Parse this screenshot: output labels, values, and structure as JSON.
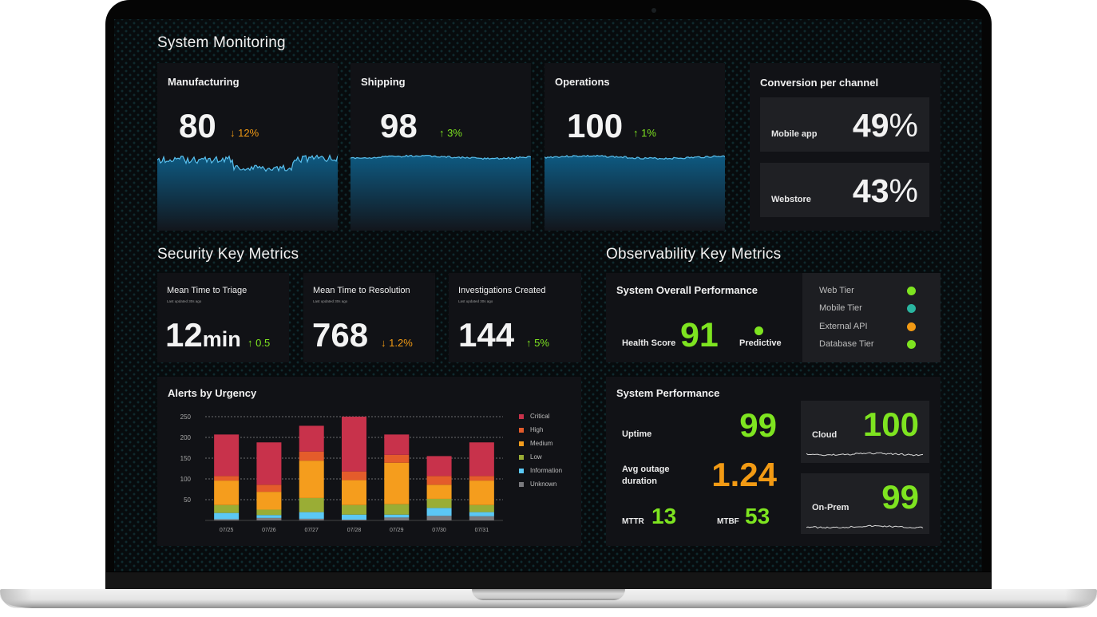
{
  "system_monitoring": {
    "title": "System Monitoring",
    "cards": [
      {
        "name": "Manufacturing",
        "value": "80",
        "delta": "12%",
        "direction": "down",
        "arrow": "↓"
      },
      {
        "name": "Shipping",
        "value": "98",
        "delta": "3%",
        "direction": "up",
        "arrow": "↑"
      },
      {
        "name": "Operations",
        "value": "100",
        "delta": "1%",
        "direction": "up",
        "arrow": "↑"
      }
    ]
  },
  "conversion": {
    "title": "Conversion per channel",
    "channels": [
      {
        "label": "Mobile app",
        "value": "49",
        "unit": "%"
      },
      {
        "label": "Webstore",
        "value": "43",
        "unit": "%"
      }
    ]
  },
  "security": {
    "title": "Security Key Metrics",
    "cards": [
      {
        "title": "Mean Time to Triage",
        "updated": "Last updated 30s ago",
        "value": "12",
        "unit": "min",
        "delta": "0.5",
        "arrow": "↑",
        "direction": "up"
      },
      {
        "title": "Mean Time to Resolution",
        "updated": "Last updated 30s ago",
        "value": "768",
        "unit": "",
        "delta": "1.2%",
        "arrow": "↓",
        "direction": "down"
      },
      {
        "title": "Investigations Created",
        "updated": "Last updated 30s ago",
        "value": "144",
        "unit": "",
        "delta": "5%",
        "arrow": "↑",
        "direction": "up"
      }
    ]
  },
  "alerts": {
    "title": "Alerts by Urgency"
  },
  "chart_data": {
    "type": "bar",
    "stacked": true,
    "title": "Alerts by Urgency",
    "xlabel": "",
    "ylabel": "",
    "categories": [
      "07/25",
      "07/26",
      "07/27",
      "07/28",
      "07/29",
      "07/30",
      "07/31"
    ],
    "ylim": [
      0,
      250
    ],
    "yticks": [
      50,
      100,
      150,
      200,
      250
    ],
    "grid": true,
    "legend_position": "right",
    "series": [
      {
        "name": "Unknown",
        "color": "#7a7a7e",
        "values": [
          3,
          6,
          4,
          2,
          7,
          11,
          10
        ]
      },
      {
        "name": "Information",
        "color": "#5bc8f5",
        "values": [
          15,
          7,
          16,
          12,
          7,
          19,
          10
        ]
      },
      {
        "name": "Low",
        "color": "#9aad35",
        "values": [
          19,
          13,
          34,
          23,
          25,
          22,
          17
        ]
      },
      {
        "name": "Medium",
        "color": "#f59d1d",
        "values": [
          59,
          43,
          90,
          60,
          100,
          34,
          59
        ]
      },
      {
        "name": "High",
        "color": "#e45c2b",
        "values": [
          11,
          17,
          22,
          21,
          19,
          21,
          11
        ]
      },
      {
        "name": "Critical",
        "color": "#c8324b",
        "values": [
          100,
          102,
          62,
          132,
          49,
          48,
          81
        ]
      }
    ],
    "legend_order": [
      "Critical",
      "High",
      "Medium",
      "Low",
      "Information",
      "Unknown"
    ]
  },
  "observability": {
    "title": "Observability Key Metrics",
    "overall": {
      "title": "System Overall Performance",
      "health_label": "Health Score",
      "health_value": "91",
      "predictive_label": "Predictive",
      "predictive_color": "#7ee420",
      "tiers": [
        {
          "label": "Web Tier",
          "color": "#7ee420"
        },
        {
          "label": "Mobile Tier",
          "color": "#2ab5a0"
        },
        {
          "label": "External API",
          "color": "#f29a14"
        },
        {
          "label": "Database Tier",
          "color": "#7ee420"
        }
      ]
    },
    "performance": {
      "title": "System Performance",
      "uptime_label": "Uptime",
      "uptime_value": "99",
      "outage_label_1": "Avg outage",
      "outage_label_2": "duration",
      "outage_value": "1.24",
      "mttr_label": "MTTR",
      "mttr_value": "13",
      "mtbf_label": "MTBF",
      "mtbf_value": "53",
      "cloud_label": "Cloud",
      "cloud_value": "100",
      "onprem_label": "On-Prem",
      "onprem_value": "99"
    }
  },
  "colors": {
    "up": "#7ee420",
    "down": "#f29a14",
    "card_bg": "#111216",
    "area_fill": "#0e5a82",
    "area_line": "#5ac0ee"
  }
}
